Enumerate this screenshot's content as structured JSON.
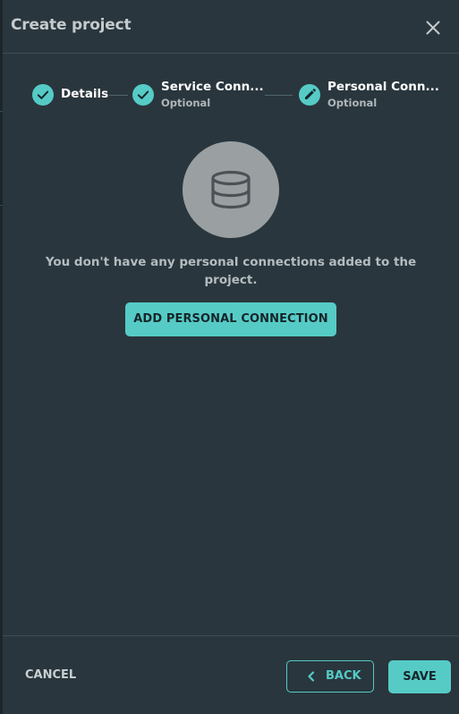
{
  "dialog": {
    "title": "Create project",
    "close_icon": "close-icon"
  },
  "stepper": {
    "steps": [
      {
        "label": "Details",
        "sublabel": "",
        "state": "completed",
        "icon": "check-icon"
      },
      {
        "label": "Service Conn...",
        "sublabel": "Optional",
        "state": "completed",
        "icon": "check-icon"
      },
      {
        "label": "Personal Conn...",
        "sublabel": "Optional",
        "state": "active",
        "icon": "pencil-icon"
      }
    ]
  },
  "empty_state": {
    "icon": "database-icon",
    "message": "You don't have any personal connections added to the project.",
    "action_label": "ADD PERSONAL CONNECTION"
  },
  "footer": {
    "cancel_label": "CANCEL",
    "back_label": "BACK",
    "back_icon": "chevron-left-icon",
    "save_label": "SAVE"
  },
  "colors": {
    "accent": "#56cbc6",
    "background": "#29363d",
    "text_primary": "#ffffff",
    "text_muted": "#aeb6b9"
  }
}
